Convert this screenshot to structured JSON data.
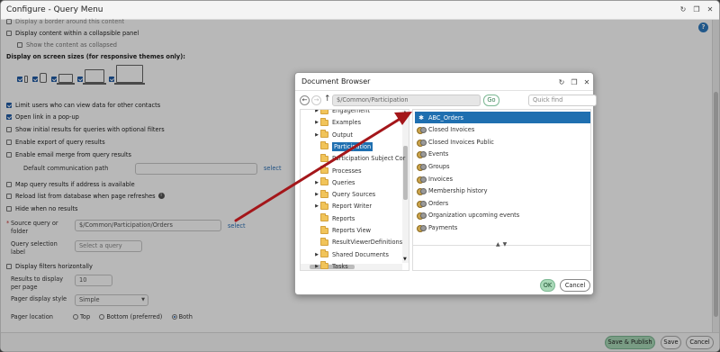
{
  "window": {
    "title": "Configure - Query Menu",
    "refresh_icon": "refresh-icon",
    "restore_icon": "restore-icon",
    "close_icon": "close-icon",
    "help": "?"
  },
  "settings": {
    "top_partial": "Display a border around this content",
    "collapsible": "Display content within a collapsible panel",
    "show_collapsed": "Show the content as collapsed",
    "screen_sizes_label": "Display on screen sizes (for responsive themes only):",
    "limit_users": "Limit users who can view data for other contacts",
    "open_popup": "Open link in a pop-up",
    "show_initial": "Show initial results for queries with optional filters",
    "enable_export": "Enable export of query results",
    "enable_email_merge": "Enable email merge from query results",
    "default_comm_path": "Default communication path",
    "select_1": "select",
    "map_results": "Map query results if address is available",
    "reload_list": "Reload list from database when page refreshes",
    "hide_no_results": "Hide when no results",
    "source_query_label": "Source query or folder",
    "source_query_value": "$/Common/Participation/Orders",
    "select_2": "select",
    "query_selection_label": "Query selection label",
    "query_selection_placeholder": "Select a query",
    "display_filters": "Display filters horizontally",
    "results_per_page_label": "Results to display per page",
    "results_per_page_value": "10",
    "pager_style_label": "Pager display style",
    "pager_style_value": "Simple",
    "pager_location_label": "Pager location",
    "pager_top": "Top",
    "pager_bottom": "Bottom (preferred)",
    "pager_both": "Both",
    "required_marker": "*",
    "info_glyph": "i"
  },
  "footer": {
    "save_publish": "Save & Publish",
    "save": "Save",
    "cancel": "Cancel"
  },
  "document_browser": {
    "title": "Document Browser",
    "back": "←",
    "forward": "→",
    "up": "↑",
    "path": "$/Common/Participation",
    "go": "Go",
    "quick_find_placeholder": "Quick find",
    "tree": [
      {
        "label": "Engagement",
        "expandable": true,
        "selected": false
      },
      {
        "label": "Examples",
        "expandable": true,
        "selected": false
      },
      {
        "label": "Output",
        "expandable": true,
        "selected": false
      },
      {
        "label": "Participation",
        "expandable": false,
        "selected": true
      },
      {
        "label": "Participation Subject Cor",
        "expandable": false,
        "selected": false
      },
      {
        "label": "Processes",
        "expandable": false,
        "selected": false
      },
      {
        "label": "Queries",
        "expandable": true,
        "selected": false
      },
      {
        "label": "Query Sources",
        "expandable": true,
        "selected": false
      },
      {
        "label": "Report Writer",
        "expandable": true,
        "selected": false
      },
      {
        "label": "Reports",
        "expandable": false,
        "selected": false
      },
      {
        "label": "Reports View",
        "expandable": false,
        "selected": false
      },
      {
        "label": "ResultViewerDefinitions",
        "expandable": false,
        "selected": false
      },
      {
        "label": "Shared Documents",
        "expandable": true,
        "selected": false
      },
      {
        "label": "Tasks",
        "expandable": true,
        "selected": false
      }
    ],
    "items": [
      {
        "label": "ABC_Orders",
        "selected": true
      },
      {
        "label": "Closed Invoices",
        "selected": false
      },
      {
        "label": "Closed Invoices Public",
        "selected": false
      },
      {
        "label": "Events",
        "selected": false
      },
      {
        "label": "Groups",
        "selected": false
      },
      {
        "label": "Invoices",
        "selected": false
      },
      {
        "label": "Membership history",
        "selected": false
      },
      {
        "label": "Orders",
        "selected": false
      },
      {
        "label": "Organization upcoming events",
        "selected": false
      },
      {
        "label": "Payments",
        "selected": false
      }
    ],
    "ok": "OK",
    "cancel": "Cancel"
  },
  "colors": {
    "accent": "#1f6fb0",
    "primary_button": "#a8d8b7",
    "arrow": "#a4161a"
  }
}
